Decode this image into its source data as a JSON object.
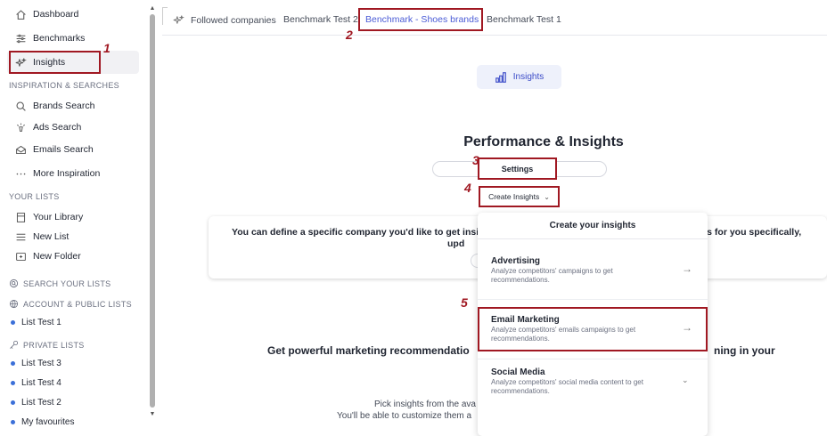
{
  "sidebar": {
    "items": [
      {
        "label": "Dashboard",
        "icon": "home-icon"
      },
      {
        "label": "Benchmarks",
        "icon": "sliders-icon"
      },
      {
        "label": "Insights",
        "icon": "sparkles-icon",
        "active": true
      }
    ],
    "section_inspiration": "INSPIRATION & SEARCHES",
    "inspiration_items": [
      {
        "label": "Brands Search",
        "icon": "search-icon"
      },
      {
        "label": "Ads Search",
        "icon": "ads-icon"
      },
      {
        "label": "Emails Search",
        "icon": "mail-icon"
      },
      {
        "label": "More Inspiration",
        "icon": "ellipsis-icon"
      }
    ],
    "section_lists": "YOUR LISTS",
    "list_items": [
      {
        "label": "Your Library",
        "icon": "bookmark-icon"
      },
      {
        "label": "New List",
        "icon": "list-icon"
      },
      {
        "label": "New Folder",
        "icon": "folder-plus-icon"
      }
    ],
    "section_search_lists": "SEARCH YOUR LISTS",
    "section_account_lists": "ACCOUNT & PUBLIC LISTS",
    "account_lists": [
      "List Test 1"
    ],
    "section_private_lists": "PRIVATE LISTS",
    "private_lists": [
      "List Test 3",
      "List Test 4",
      "List Test 2",
      "My favourites"
    ]
  },
  "tabs": {
    "followed": "Followed companies",
    "bt2": "Benchmark Test 2",
    "shoes": "Benchmark - Shoes brands",
    "bt1": "Benchmark Test 1"
  },
  "main": {
    "insights_pill": "Insights",
    "title": "Performance & Insights",
    "settings": "Settings",
    "create_insights": "Create Insights",
    "info_1": "You can define a specific company you'd like to get insights",
    "info_2": "ples for you specifically,",
    "info_3": "upd",
    "powerful_1": "Get powerful marketing recommendatio",
    "powerful_2": "ning in your",
    "pick_1": "Pick insights from the ava",
    "pick_2": "You'll be able to customize them a"
  },
  "dropdown": {
    "header": "Create your insights",
    "items": [
      {
        "title": "Advertising",
        "desc": "Analyze competitors' campaigns to get recommendations."
      },
      {
        "title": "Email Marketing",
        "desc": "Analyze competitors' emails campaigns to get recommendations."
      },
      {
        "title": "Social Media",
        "desc": "Analyze competitors' social media content to get recommendations."
      }
    ]
  },
  "steps": [
    "1",
    "2",
    "3",
    "4",
    "5"
  ],
  "colors": {
    "annotation": "#a01822",
    "accent": "#4a5bd6"
  }
}
